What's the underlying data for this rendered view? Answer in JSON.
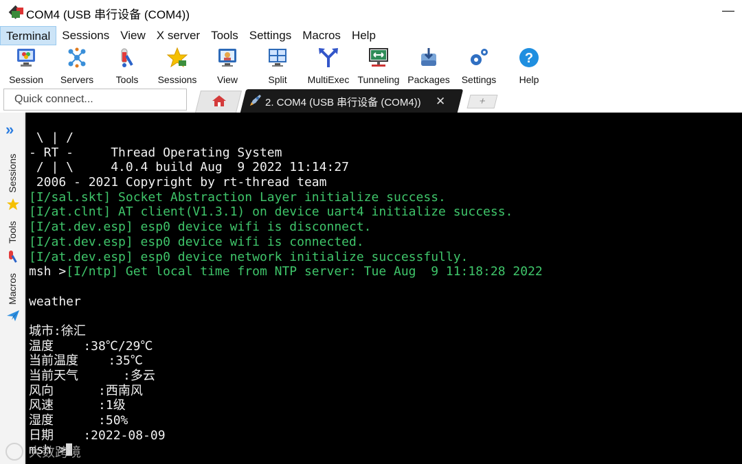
{
  "window": {
    "title": "COM4  (USB 串行设备 (COM4))"
  },
  "menubar": {
    "items": [
      "Terminal",
      "Sessions",
      "View",
      "X server",
      "Tools",
      "Settings",
      "Macros",
      "Help"
    ],
    "active": "Terminal"
  },
  "toolbar": {
    "items": [
      {
        "label": "Session",
        "icon": "session-icon"
      },
      {
        "label": "Servers",
        "icon": "servers-icon"
      },
      {
        "label": "Tools",
        "icon": "tools-icon"
      },
      {
        "label": "Sessions",
        "icon": "star-icon"
      },
      {
        "label": "View",
        "icon": "view-icon"
      },
      {
        "label": "Split",
        "icon": "split-icon"
      },
      {
        "label": "MultiExec",
        "icon": "multiexec-icon"
      },
      {
        "label": "Tunneling",
        "icon": "tunneling-icon"
      },
      {
        "label": "Packages",
        "icon": "packages-icon"
      },
      {
        "label": "Settings",
        "icon": "settings-icon"
      },
      {
        "label": "Help",
        "icon": "help-icon"
      }
    ]
  },
  "quick_connect": {
    "placeholder": "Quick connect..."
  },
  "tabs": {
    "active_label": "2. COM4  (USB 串行设备 (COM4))",
    "close_glyph": "✕",
    "new_glyph": "+"
  },
  "sidebar": {
    "tabs": [
      "Sessions",
      "Tools",
      "Macros"
    ]
  },
  "terminal": {
    "lines": [
      {
        "text": " \\ | /",
        "color": "white"
      },
      {
        "text": "- RT -     Thread Operating System",
        "color": "white"
      },
      {
        "text": " / | \\     4.0.4 build Aug  9 2022 11:14:27",
        "color": "white"
      },
      {
        "text": " 2006 - 2021 Copyright by rt-thread team",
        "color": "white"
      },
      {
        "text": "[I/sal.skt] Socket Abstraction Layer initialize success.",
        "color": "green"
      },
      {
        "text": "[I/at.clnt] AT client(V1.3.1) on device uart4 initialize success.",
        "color": "green"
      },
      {
        "text": "[I/at.dev.esp] esp0 device wifi is disconnect.",
        "color": "green"
      },
      {
        "text": "[I/at.dev.esp] esp0 device wifi is connected.",
        "color": "green"
      },
      {
        "text": "[I/at.dev.esp] esp0 device network initialize successfully.",
        "color": "green"
      },
      {
        "prefix": "msh >",
        "text": "[I/ntp] Get local time from NTP server: Tue Aug  9 11:18:28 2022",
        "color": "green"
      },
      {
        "text": "",
        "color": "white"
      },
      {
        "text": "weather",
        "color": "white"
      },
      {
        "text": "",
        "color": "white"
      },
      {
        "text": "城市:徐汇",
        "color": "white"
      },
      {
        "text": "温度    :38℃/29℃",
        "color": "white"
      },
      {
        "text": "当前温度    :35℃",
        "color": "white"
      },
      {
        "text": "当前天气      :多云",
        "color": "white"
      },
      {
        "text": "风向      :西南风",
        "color": "white"
      },
      {
        "text": "风速      :1级",
        "color": "white"
      },
      {
        "text": "湿度      :50%",
        "color": "white"
      },
      {
        "text": "日期    :2022-08-09",
        "color": "white"
      },
      {
        "text": "msh >",
        "color": "white",
        "cursor": true
      }
    ]
  },
  "watermark": {
    "text": "大数跨境"
  },
  "colors": {
    "terminal_bg": "#000000",
    "terminal_green": "#3fc56a",
    "accent_blue": "#2b7de0"
  }
}
